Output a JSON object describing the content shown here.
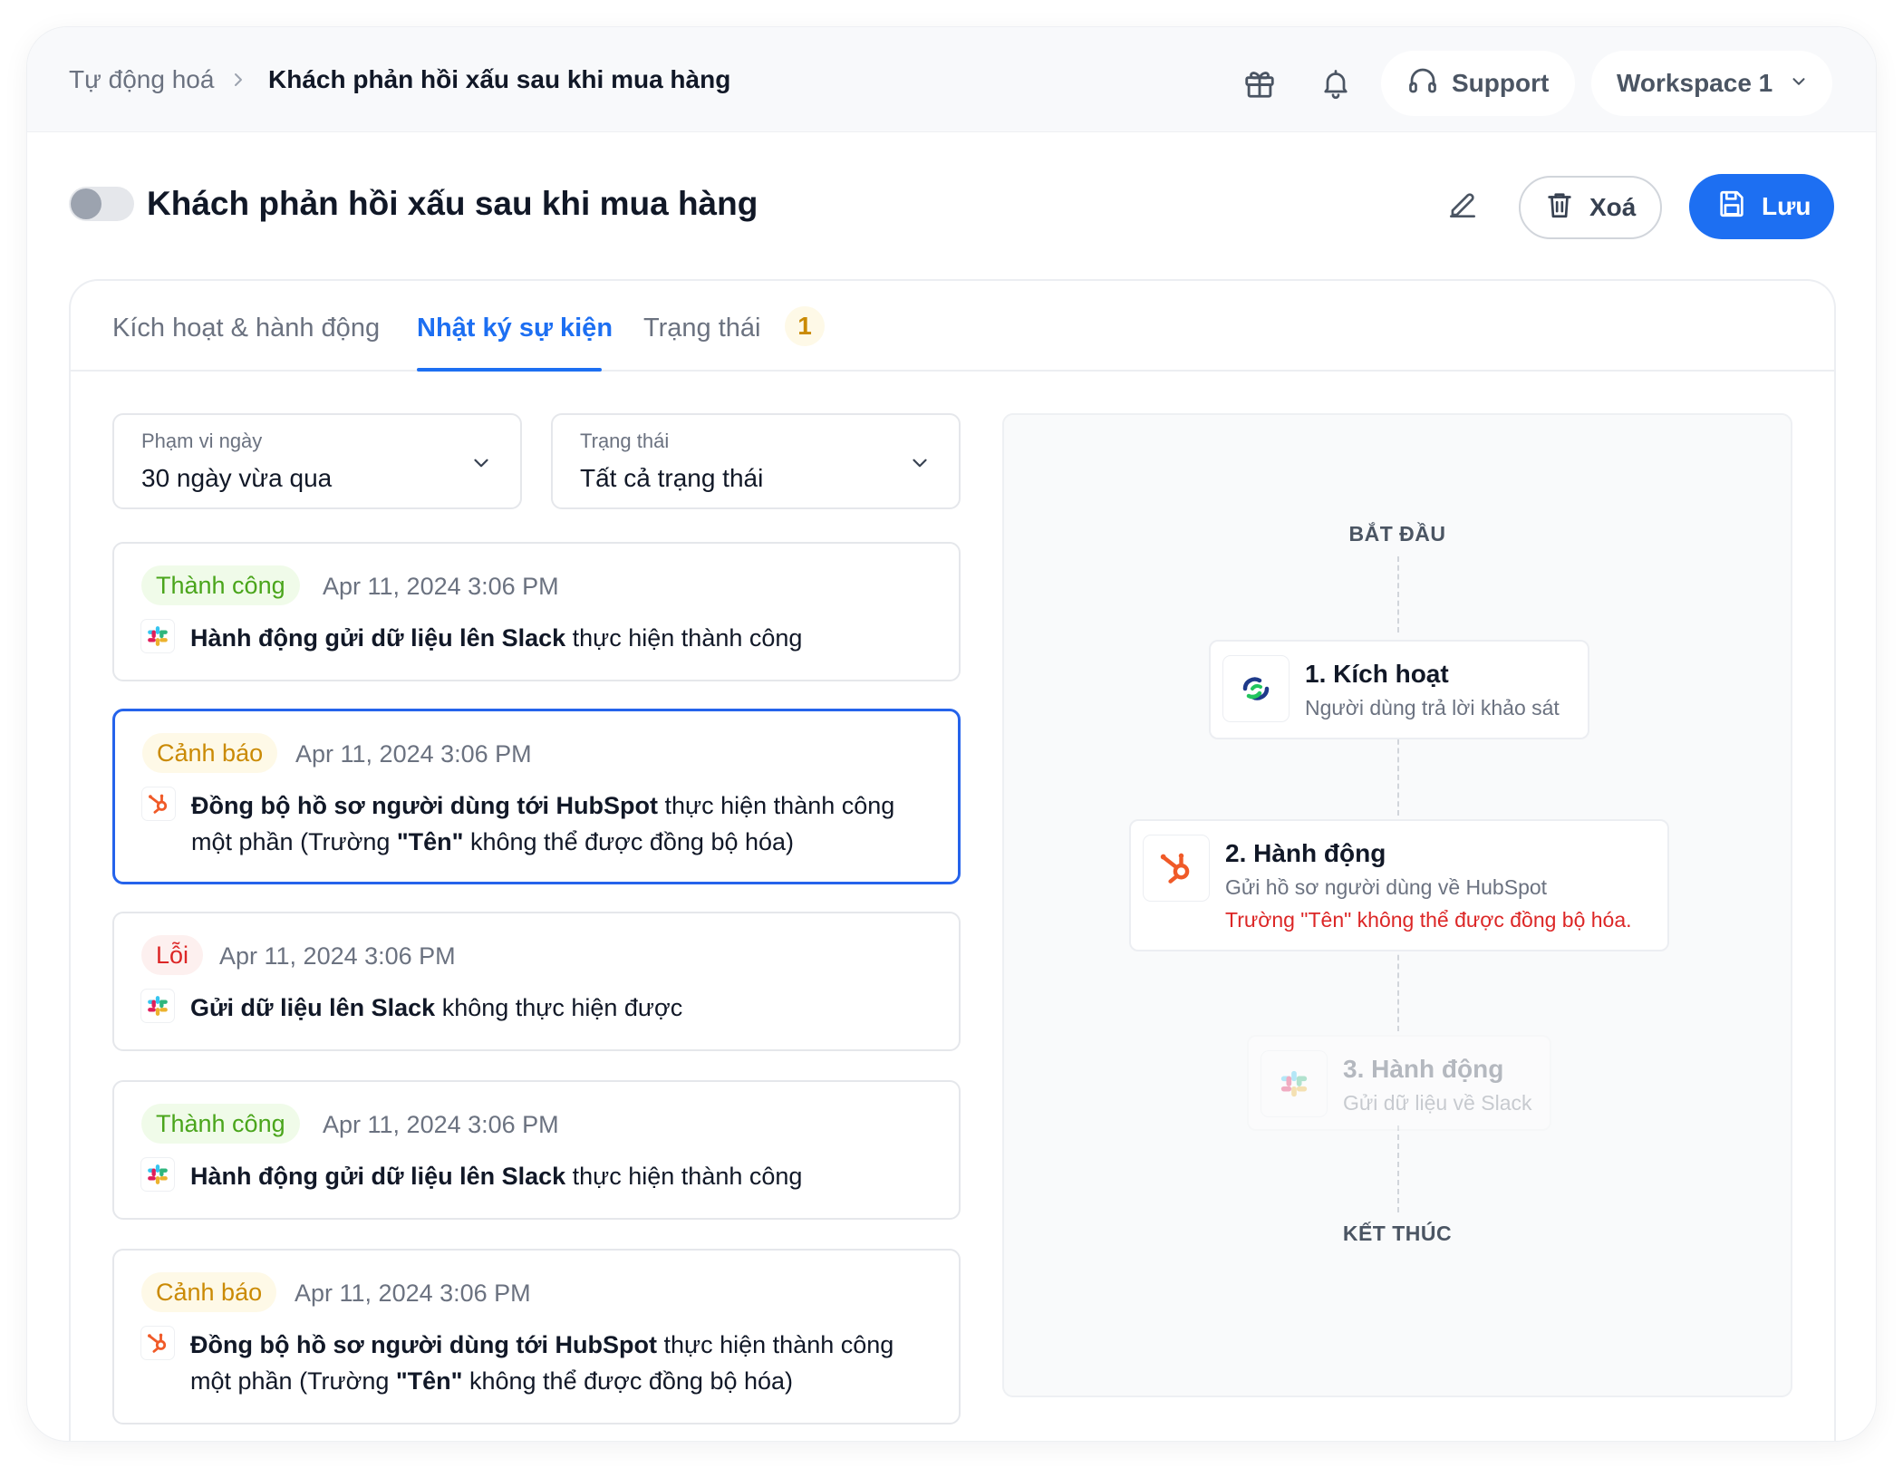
{
  "breadcrumb": {
    "root": "Tự động hoá",
    "current": "Khách phản hồi xấu sau khi mua hàng"
  },
  "header": {
    "support_label": "Support",
    "workspace_label": "Workspace 1"
  },
  "page": {
    "title": "Khách phản hồi xấu sau khi mua hàng",
    "enabled": false,
    "delete_label": "Xoá",
    "save_label": "Lưu"
  },
  "tabs": [
    {
      "label": "Kích hoạt & hành động",
      "active": false
    },
    {
      "label": "Nhật ký sự kiện",
      "active": true
    },
    {
      "label": "Trạng thái",
      "active": false,
      "badge": "1"
    }
  ],
  "filters": {
    "date": {
      "label": "Phạm vi ngày",
      "value": "30 ngày vừa qua"
    },
    "status": {
      "label": "Trạng thái",
      "value": "Tất cả trạng thái"
    }
  },
  "logs": [
    {
      "status": "Thành công",
      "type": "success",
      "time": "Apr 11, 2024 3:06 PM",
      "icon": "slack-icon",
      "bold": "Hành động gửi dữ liệu lên Slack",
      "rest": " thực hiện thành công"
    },
    {
      "status": "Cảnh báo",
      "type": "warning",
      "time": "Apr 11, 2024 3:06 PM",
      "icon": "hubspot-icon",
      "bold": "Đồng bộ hồ sơ người dùng tới HubSpot",
      "rest": " thực hiện thành công một phần (Trường ",
      "bold2": "\"Tên\"",
      "rest2": " không thể được đồng bộ hóa)",
      "selected": true
    },
    {
      "status": "Lỗi",
      "type": "error",
      "time": "Apr 11, 2024 3:06 PM",
      "icon": "slack-icon",
      "bold": "Gửi dữ liệu lên Slack",
      "rest": " không thực hiện được"
    },
    {
      "status": "Thành công",
      "type": "success",
      "time": "Apr 11, 2024 3:06 PM",
      "icon": "slack-icon",
      "bold": "Hành động gửi dữ liệu lên Slack",
      "rest": " thực hiện thành công"
    },
    {
      "status": "Cảnh báo",
      "type": "warning",
      "time": "Apr 11, 2024 3:06 PM",
      "icon": "hubspot-icon",
      "bold": "Đồng bộ hồ sơ người dùng tới HubSpot",
      "rest": " thực hiện thành công một phần (Trường ",
      "bold2": "\"Tên\"",
      "rest2": " không thể được đồng bộ hóa)"
    }
  ],
  "flow": {
    "start_label": "BẮT ĐẦU",
    "end_label": "KẾT THÚC",
    "nodes": [
      {
        "title": "1. Kích hoạt",
        "subtitle": "Người dùng trả lời khảo sát",
        "icon": "survey-icon"
      },
      {
        "title": "2. Hành động",
        "subtitle": "Gửi hồ sơ người dùng về HubSpot",
        "error": "Trường \"Tên\" không thể được đồng bộ hóa.",
        "icon": "hubspot-icon"
      },
      {
        "title": "3. Hành động",
        "subtitle": "Gửi dữ liệu về Slack",
        "icon": "slack-icon",
        "faded": true
      }
    ]
  },
  "colors": {
    "accent": "#1d6ff2",
    "success": "#4aa51b",
    "warning": "#ca8a04",
    "error": "#dc2626"
  }
}
